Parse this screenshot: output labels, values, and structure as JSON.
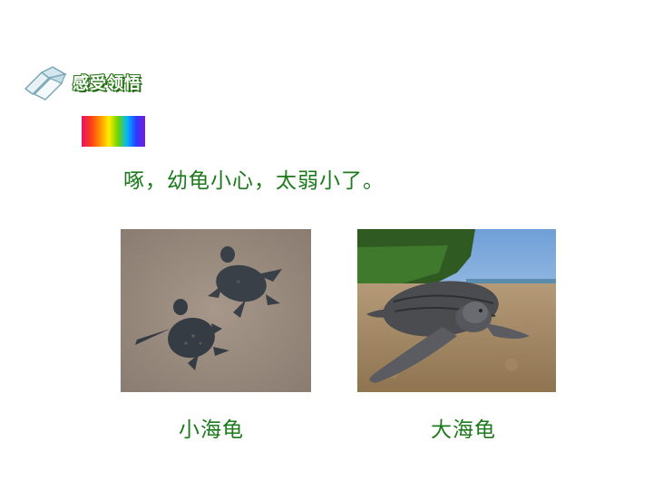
{
  "header": {
    "title": "感受领悟",
    "icon": "open-book-icon"
  },
  "main": {
    "sentence": "啄，幼龟小心，太弱小了。"
  },
  "images": [
    {
      "caption": "小海龟"
    },
    {
      "caption": "大海龟"
    }
  ],
  "colors": {
    "text_green": "#1c7a1c",
    "title_outline": "#2f7d1e"
  }
}
